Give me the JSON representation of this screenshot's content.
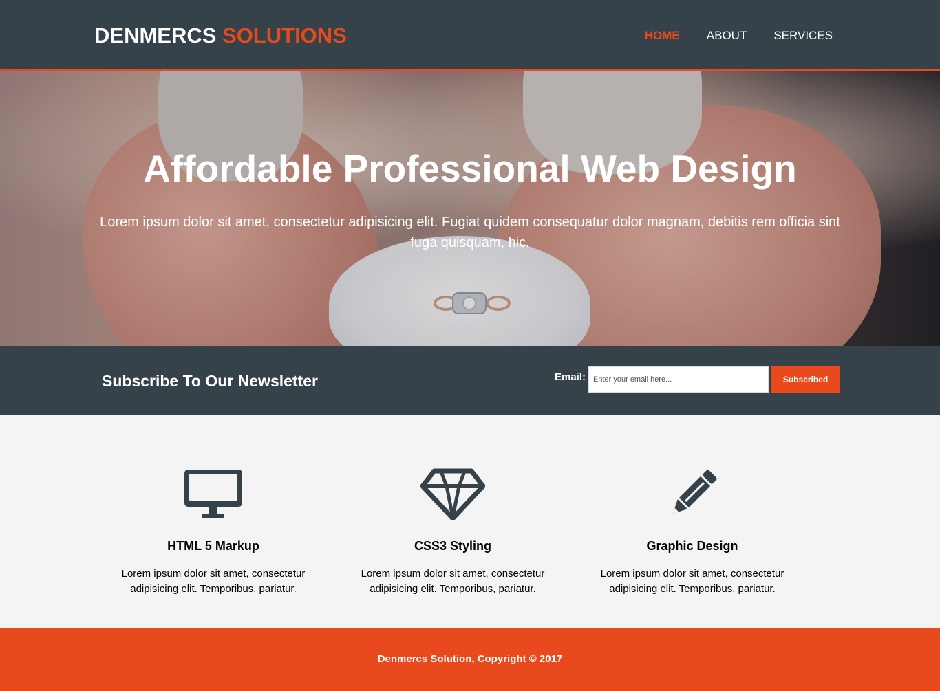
{
  "header": {
    "brand_part1": "DENMERCS ",
    "brand_part2": "SOLUTIONS",
    "nav": [
      {
        "label": "HOME",
        "active": true
      },
      {
        "label": "ABOUT",
        "active": false
      },
      {
        "label": "SERVICES",
        "active": false
      }
    ]
  },
  "showcase": {
    "title": "Affordable Professional Web Design",
    "text": "Lorem ipsum dolor sit amet, consectetur adipisicing elit. Fugiat quidem consequatur dolor magnam, debitis rem officia sint fuga quisquam, hic."
  },
  "newsletter": {
    "heading": "Subscribe To Our Newsletter",
    "email_label": "Email:",
    "email_placeholder": "Enter your email here...",
    "button_label": "Subscribed"
  },
  "boxes": [
    {
      "icon": "monitor-icon",
      "title": "HTML 5 Markup",
      "text": "Lorem ipsum dolor sit amet, consectetur adipisicing elit. Temporibus, pariatur."
    },
    {
      "icon": "diamond-icon",
      "title": "CSS3 Styling",
      "text": "Lorem ipsum dolor sit amet, consectetur adipisicing elit. Temporibus, pariatur."
    },
    {
      "icon": "pencil-icon",
      "title": "Graphic Design",
      "text": "Lorem ipsum dolor sit amet, consectetur adipisicing elit. Temporibus, pariatur."
    }
  ],
  "footer": {
    "copyright": "Denmercs Solution, Copyright © 2017"
  },
  "colors": {
    "header_bg": "#35424a",
    "accent": "#e8491d",
    "section_bg": "#f4f4f4"
  }
}
